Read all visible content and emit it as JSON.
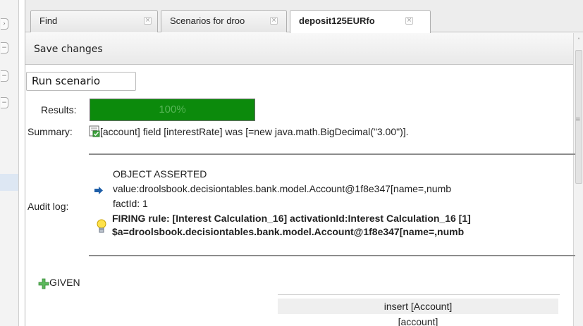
{
  "left_strip": {
    "buttons": [
      "›",
      "−",
      "−",
      "−"
    ]
  },
  "tabs": [
    {
      "label": "Find",
      "close": "×"
    },
    {
      "label": "Scenarios for droo",
      "close": "×"
    },
    {
      "label": "deposit125EURfo",
      "close": "×",
      "active": true
    }
  ],
  "toolbar": {
    "save_label": "Save changes"
  },
  "scrollbar": {
    "up_arrow": "˄",
    "grip": "≡"
  },
  "scenario": {
    "run_label": "Run scenario",
    "results_label": "Results:",
    "progress_percent": 100,
    "progress_text": "100%",
    "progress_color": "#0c8a0c",
    "summary_label": "Summary:",
    "summary_icon": "checklist-icon",
    "summary_text": "[account] field [interestRate] was [=new java.math.BigDecimal(\"3.00\")].",
    "audit_label": "Audit log:",
    "audit": {
      "object_asserted": "OBJECT ASSERTED",
      "value_line": "value:droolsbook.decisiontables.bank.model.Account@1f8e347[name=,numb",
      "fact_id": "factId: 1",
      "firing_rule": "FIRING rule: [Interest Calculation_16] activationId:Interest Calculation_16 [1]",
      "binding": "$a=droolsbook.decisiontables.bank.model.Account@1f8e347[name=,numb",
      "arrow_icon": "arrow-right-icon",
      "bulb_icon": "lightbulb-icon"
    },
    "given_label": "GIVEN",
    "insert_header": "insert [Account]",
    "insert_cell": "[account]"
  },
  "colors": {
    "accent_green": "#0c8a0c",
    "arrow_blue": "#1f5fa8"
  }
}
